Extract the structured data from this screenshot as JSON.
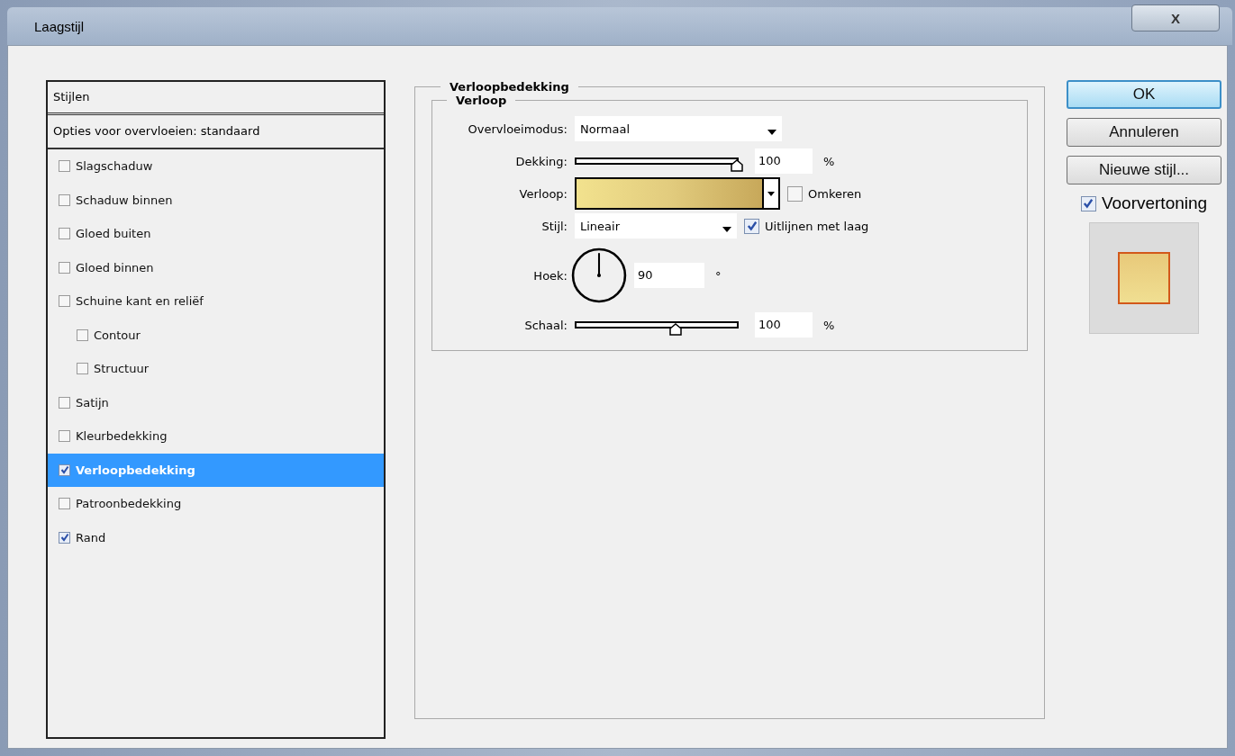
{
  "window": {
    "title": "Laagstijl",
    "close_label": "X"
  },
  "styles_list": {
    "header": "Stijlen",
    "blending_options": "Opties voor overvloeien: standaard",
    "items": [
      {
        "label": "Slagschaduw",
        "checked": false,
        "selected": false
      },
      {
        "label": "Schaduw binnen",
        "checked": false,
        "selected": false
      },
      {
        "label": "Gloed buiten",
        "checked": false,
        "selected": false
      },
      {
        "label": "Gloed binnen",
        "checked": false,
        "selected": false
      },
      {
        "label": "Schuine kant en reliëf",
        "checked": false,
        "selected": false,
        "children": [
          {
            "label": "Contour",
            "checked": false,
            "selected": false
          },
          {
            "label": "Structuur",
            "checked": false,
            "selected": false
          }
        ]
      },
      {
        "label": "Satijn",
        "checked": false,
        "selected": false
      },
      {
        "label": "Kleurbedekking",
        "checked": false,
        "selected": false
      },
      {
        "label": "Verloopbedekking",
        "checked": true,
        "selected": true
      },
      {
        "label": "Patroonbedekking",
        "checked": false,
        "selected": false
      },
      {
        "label": "Rand",
        "checked": true,
        "selected": false
      }
    ]
  },
  "panel": {
    "title": "Verloopbedekking",
    "group_title": "Verloop",
    "blend_mode": {
      "label": "Overvloeimodus:",
      "value": "Normaal"
    },
    "opacity": {
      "label": "Dekking:",
      "level": 1.0,
      "value": "100",
      "unit": "%"
    },
    "gradient": {
      "label": "Verloop:",
      "reverse": {
        "label": "Omkeren",
        "checked": false
      }
    },
    "style": {
      "label": "Stijl:",
      "value": "Lineair",
      "align": {
        "label": "Uitlijnen met laag",
        "checked": true
      }
    },
    "angle": {
      "label": "Hoek:",
      "value": "90",
      "unit": "°"
    },
    "scale": {
      "label": "Schaal:",
      "level": 0.62,
      "value": "100",
      "unit": "%"
    }
  },
  "buttons": [
    {
      "label": "OK",
      "default": true
    },
    {
      "label": "Annuleren",
      "default": false
    },
    {
      "label": "Nieuwe stijl...",
      "default": false
    }
  ],
  "preview": {
    "label": "Voorvertoning",
    "checked": true
  }
}
